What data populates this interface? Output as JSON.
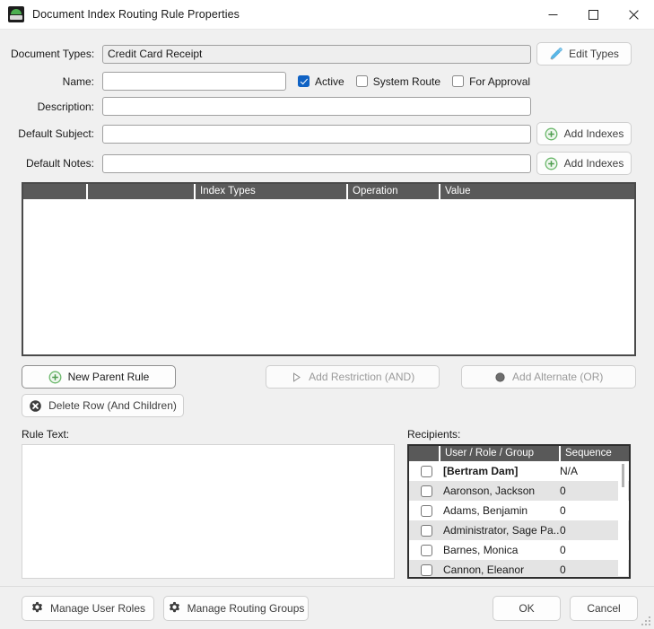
{
  "window": {
    "title": "Document Index Routing Rule Properties",
    "icon": "app-icon",
    "minimize": "minimize-icon",
    "maximize": "maximize-icon",
    "close": "close-icon"
  },
  "form": {
    "document_types": {
      "label": "Document Types:",
      "value": "Credit Card Receipt",
      "placeholder": "",
      "readonly": true
    },
    "name": {
      "label": "Name:",
      "value": "",
      "placeholder": ""
    },
    "description": {
      "label": "Description:",
      "value": "",
      "placeholder": ""
    },
    "default_subject": {
      "label": "Default Subject:",
      "value": "",
      "placeholder": ""
    },
    "default_notes": {
      "label": "Default Notes:",
      "value": "",
      "placeholder": ""
    },
    "checkboxes": [
      {
        "label": "Active",
        "checked": true
      },
      {
        "label": "System Route",
        "checked": false
      },
      {
        "label": "For Approval",
        "checked": false
      }
    ],
    "buttons": {
      "edit_types": {
        "label": "Edit Types",
        "icon": "pencil-icon"
      },
      "add_indexes_subject": {
        "label": "Add Indexes",
        "icon": "plus-circle-icon"
      },
      "add_indexes_notes": {
        "label": "Add Indexes",
        "icon": "plus-circle-icon"
      }
    }
  },
  "grid": {
    "columns": [
      "",
      "",
      "Index Types",
      "Operation",
      "Value"
    ],
    "rows": []
  },
  "rule_buttons": {
    "new_parent_rule": {
      "label": "New Parent Rule",
      "icon": "plus-circle-icon",
      "disabled": false
    },
    "delete_row": {
      "label": "Delete Row (And Children)",
      "icon": "delete-circle-icon",
      "disabled": false
    },
    "add_restriction": {
      "label": "Add Restriction (AND)",
      "icon": "triangle-right-icon",
      "disabled": true
    },
    "add_alternate": {
      "label": "Add Alternate (OR)",
      "icon": "circle-icon",
      "disabled": true
    }
  },
  "rule_text": {
    "label": "Rule Text:",
    "value": "",
    "placeholder": ""
  },
  "recipients": {
    "label": "Recipients:",
    "columns": [
      "",
      "User / Role / Group",
      "Sequence"
    ],
    "rows": [
      {
        "checked": false,
        "name": "[Bertram Dam]",
        "sequence": "N/A",
        "bold": true
      },
      {
        "checked": false,
        "name": "Aaronson, Jackson",
        "sequence": "0",
        "bold": false
      },
      {
        "checked": false,
        "name": "Adams, Benjamin",
        "sequence": "0",
        "bold": false
      },
      {
        "checked": false,
        "name": "Administrator, Sage Pa...",
        "sequence": "0",
        "bold": false
      },
      {
        "checked": false,
        "name": "Barnes, Monica",
        "sequence": "0",
        "bold": false
      },
      {
        "checked": false,
        "name": "Cannon, Eleanor",
        "sequence": "0",
        "bold": false
      }
    ]
  },
  "footer": {
    "manage_user_roles": {
      "label": "Manage User Roles",
      "icon": "gear-icon"
    },
    "manage_routing_groups": {
      "label": "Manage Routing Groups",
      "icon": "gear-icon"
    },
    "ok": "OK",
    "cancel": "Cancel"
  },
  "colors": {
    "accent_checkbox": "#0f62c4",
    "header_bar": "#595959",
    "pencil_icon": "#5bb8e8",
    "plus_icon": "#6cb86c",
    "background": "#f0f0f0"
  }
}
